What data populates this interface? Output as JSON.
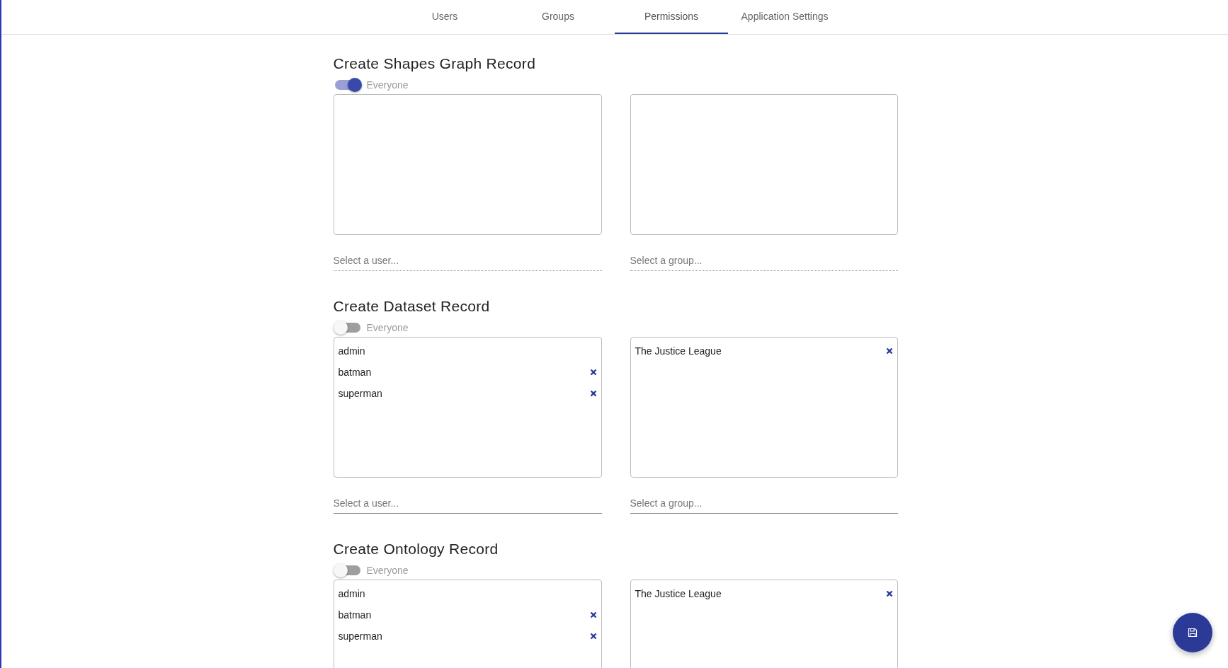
{
  "tabs": [
    {
      "label": "Users",
      "selected": false
    },
    {
      "label": "Groups",
      "selected": false
    },
    {
      "label": "Permissions",
      "selected": true
    },
    {
      "label": "Application Settings",
      "selected": false
    }
  ],
  "sections": [
    {
      "title": "Create Shapes Graph Record",
      "everyone": {
        "label": "Everyone",
        "on": true
      },
      "user_field": {
        "placeholder": "Select a user...",
        "disabled": true
      },
      "group_field": {
        "placeholder": "Select a group...",
        "disabled": true
      }
    },
    {
      "title": "Create Dataset Record",
      "everyone": {
        "label": "Everyone",
        "on": false
      },
      "users": [
        {
          "name": "admin",
          "removable": false
        },
        {
          "name": "batman",
          "removable": true
        },
        {
          "name": "superman",
          "removable": true
        }
      ],
      "groups": [
        {
          "name": "The Justice League",
          "removable": true
        }
      ],
      "user_field": {
        "placeholder": "Select a user...",
        "disabled": false
      },
      "group_field": {
        "placeholder": "Select a group...",
        "disabled": false
      }
    },
    {
      "title": "Create Ontology Record",
      "everyone": {
        "label": "Everyone",
        "on": false
      },
      "users": [
        {
          "name": "admin",
          "removable": false
        },
        {
          "name": "batman",
          "removable": true
        },
        {
          "name": "superman",
          "removable": true
        }
      ],
      "groups": [
        {
          "name": "The Justice League",
          "removable": true
        }
      ]
    }
  ]
}
